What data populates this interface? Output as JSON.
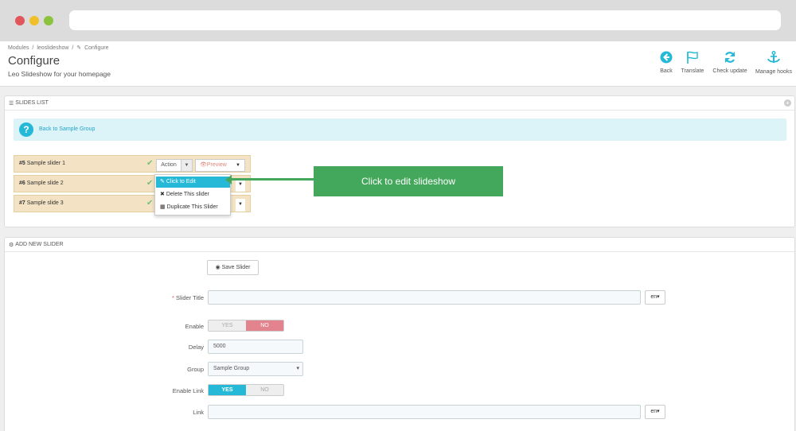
{
  "breadcrumb": [
    "Modules",
    "/",
    "leoslideshow",
    "/",
    "Configure"
  ],
  "header": {
    "title": "Configure",
    "subtitle": "Leo Slideshow for your homepage"
  },
  "toolbar": {
    "back": "Back",
    "translate": "Translate",
    "check_update": "Check update",
    "manage_hooks": "Manage hooks"
  },
  "slides_panel": {
    "heading": "SLIDES LIST",
    "back_link": "Back to Sample Group",
    "slides": [
      {
        "id": "#5",
        "name": "Sample slider 1"
      },
      {
        "id": "#6",
        "name": "Sample slide 2"
      },
      {
        "id": "#7",
        "name": "Sample slide 3"
      }
    ],
    "action_label": "Action",
    "preview_label": "Preview",
    "dropdown": {
      "edit": "Click to Edit",
      "delete": "Delete This slider",
      "duplicate": "Duplicate This Slider"
    }
  },
  "callout": "Click to edit slideshow",
  "add_panel": {
    "heading": "ADD NEW SLIDER",
    "save_label": "Save Slider",
    "fields": {
      "slider_title": "Slider Title",
      "enable": "Enable",
      "delay": "Delay",
      "group": "Group",
      "enable_link": "Enable Link",
      "link": "Link"
    },
    "lang": "en",
    "yes": "YES",
    "no": "NO",
    "delay_value": "5000",
    "group_value": "Sample Group"
  },
  "colors": {
    "accent": "#25b9d7",
    "callout": "#43a85b",
    "slide_row": "#f3e3c4",
    "switch_no": "#e3838e"
  }
}
